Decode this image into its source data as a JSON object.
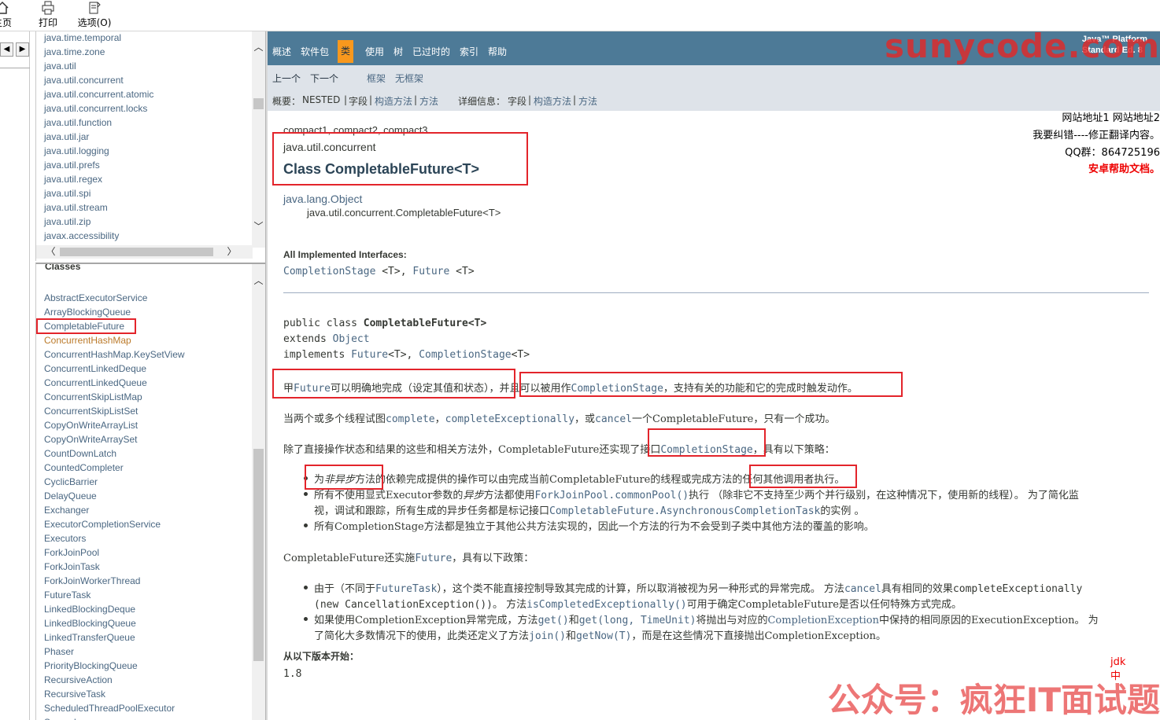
{
  "toolbar": {
    "home_label": "主页",
    "print_label": "打印",
    "options_label": "选项(O)"
  },
  "package_list": [
    "java.time.temporal",
    "java.time.zone",
    "java.util",
    "java.util.concurrent",
    "java.util.concurrent.atomic",
    "java.util.concurrent.locks",
    "java.util.function",
    "java.util.jar",
    "java.util.logging",
    "java.util.prefs",
    "java.util.regex",
    "java.util.spi",
    "java.util.stream",
    "java.util.zip",
    "javax.accessibility"
  ],
  "classes": {
    "heading": "Classes",
    "items": [
      "AbstractExecutorService",
      "ArrayBlockingQueue",
      "CompletableFuture",
      "ConcurrentHashMap",
      "ConcurrentHashMap.KeySetView",
      "ConcurrentLinkedDeque",
      "ConcurrentLinkedQueue",
      "ConcurrentSkipListMap",
      "ConcurrentSkipListSet",
      "CopyOnWriteArrayList",
      "CopyOnWriteArraySet",
      "CountDownLatch",
      "CountedCompleter",
      "CyclicBarrier",
      "DelayQueue",
      "Exchanger",
      "ExecutorCompletionService",
      "Executors",
      "ForkJoinPool",
      "ForkJoinTask",
      "ForkJoinWorkerThread",
      "FutureTask",
      "LinkedBlockingDeque",
      "LinkedBlockingQueue",
      "LinkedTransferQueue",
      "Phaser",
      "PriorityBlockingQueue",
      "RecursiveAction",
      "RecursiveTask",
      "ScheduledThreadPoolExecutor",
      "Semaphore"
    ]
  },
  "topnav": {
    "tabs": [
      "概述",
      "软件包",
      "类",
      "使用",
      "树",
      "已过时的",
      "索引",
      "帮助"
    ],
    "platform_line1": "Java™ Platform",
    "platform_line2": "Standard Ed. 8"
  },
  "subnav": {
    "prev": "上一个",
    "next": "下一个",
    "frames": "框架",
    "no_frames": "无框架",
    "summary_label": "概要：",
    "summary_nested": "NESTED",
    "sep": "|",
    "field": "字段",
    "constructor": "构造方法",
    "method": "方法",
    "detail_label": "详细信息：",
    "detail_field": "字段",
    "detail_constructor": "构造方法",
    "detail_method": "方法"
  },
  "side_notes": {
    "line1": "网站地址1 网站地址2",
    "line2": "我要纠错----修正翻译内容。",
    "line3": "QQ群：864725196",
    "line4": "安卓帮助文档。"
  },
  "header": {
    "profiles": "compact1, compact2, compact3",
    "package": "java.util.concurrent",
    "title": "Class CompletableFuture<T>"
  },
  "inheritance": {
    "root": "java.lang.Object",
    "child": "java.util.concurrent.CompletableFuture<T>"
  },
  "interfaces": {
    "label": "All Implemented Interfaces:",
    "item1": "CompletionStage",
    "item1_generic": " <T>, ",
    "item2": "Future",
    "item2_generic": " <T>"
  },
  "signature": {
    "line1_prefix": "public class ",
    "line1_name": "CompletableFuture",
    "line1_generic": "<T>",
    "line2_prefix": "extends ",
    "line2_link": "Object",
    "line3_prefix": "implements ",
    "line3_link1": "Future",
    "line3_mid": "<T>, ",
    "line3_link2": "CompletionStage",
    "line3_end": "<T>"
  },
  "description": {
    "p1_a": "甲",
    "p1_link1": "Future",
    "p1_b": "可以明确地完成（设定其值和状态），并且可以被用作",
    "p1_link2": "CompletionStage",
    "p1_c": "，支持有关的功能和它的完成时触发动作。",
    "p2_a": "当两个或多个线程试图",
    "p2_link1": "complete",
    "p2_b": "，",
    "p2_link2": "completeExceptionally",
    "p2_c": "，或",
    "p2_link3": "cancel",
    "p2_d": "一个CompletableFuture，只有一个成功。",
    "p3_a": "除了直接操作状态和结果的这些和相关方法外，CompletableFuture还实现了接口",
    "p3_link": "CompletionStage",
    "p3_b": "，具有以下策略：",
    "b1_a": "为",
    "b1_em": "非异步",
    "b1_b": "方法的依赖完成提供的操作可以由完成当前CompletableFuture的线程或完成方法的任何其他调用者执行。",
    "b2_a": "所有不使用显式Executor参数的",
    "b2_em": "异步",
    "b2_b": "方法都使用",
    "b2_link": "ForkJoinPool.commonPool()",
    "b2_c": "执行 （除非它不支持至少两个并行级别，在这种情况下，使用新的线程）。 为了简化监",
    "b2_d": "视，调试和跟踪，所有生成的异步任务都是标记接口",
    "b2_link2": "CompletableFuture.AsynchronousCompletionTask",
    "b2_e": "的实例 。",
    "b3": "所有CompletionStage方法都是独立于其他公共方法实现的，因此一个方法的行为不会受到子类中其他方法的覆盖的影响。",
    "p4_a": "CompletableFuture还实施",
    "p4_link": "Future",
    "p4_b": "，具有以下政策：",
    "c1_a": "由于（不同于",
    "c1_link1": "FutureTask",
    "c1_b": "），这个类不能直接控制导致其完成的计算，所以取消被视为另一种形式的异常完成。 方法",
    "c1_link2": "cancel",
    "c1_c": "具有相同的效果",
    "c1_mono1": "completeExceptionally",
    "c1_d": "(new CancellationException())",
    "c1_e": "。 方法",
    "c1_link3": "isCompletedExceptionally()",
    "c1_f": "可用于确定CompletableFuture是否以任何特殊方式完成。",
    "c2_a": "如果使用CompletionException异常完成，方法",
    "c2_link1": "get()",
    "c2_b": "和",
    "c2_link2": "get(long, TimeUnit)",
    "c2_c": "将抛出与对应的",
    "c2_link3": "CompletionException",
    "c2_d": "中保持的相同原因的ExecutionException。 为",
    "c2_e": "了简化大多数情况下的使用，此类还定义了方法",
    "c2_link4": "join()",
    "c2_f": "和",
    "c2_link5": "getNow(T)",
    "c2_g": "，而是在这些情况下直接抛出CompletionException。"
  },
  "since": {
    "label": "从以下版本开始：",
    "value": "1.8"
  },
  "overlays": {
    "watermark_top": "sunycode.com",
    "watermark_bottom": "公众号：疯狂IT面试题",
    "jdk_note_1": "jdk",
    "jdk_note_2": "中"
  },
  "colors": {
    "nav_bar": "#4d7a97",
    "active_tab": "#f8981d",
    "subnav_bg": "#dee3e9",
    "link": "#4a6782",
    "annotation_red": "#e3242b"
  }
}
